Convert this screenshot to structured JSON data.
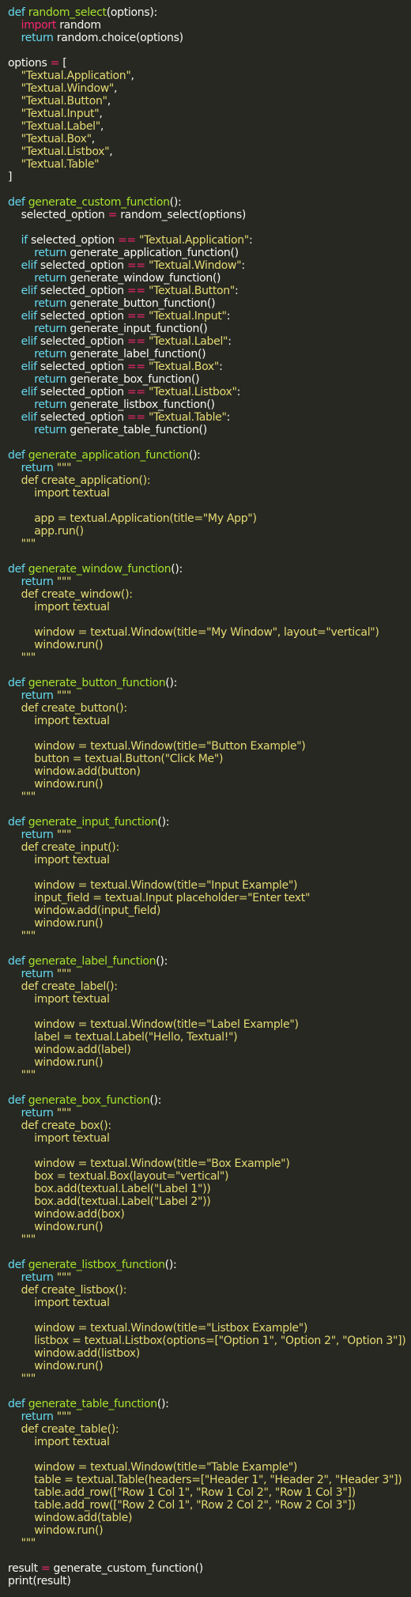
{
  "theme": {
    "background": "#272822",
    "foreground": "#f8f8f2",
    "keyword": "#66d9ef",
    "import_keyword": "#f92672",
    "function_name": "#a6e22e",
    "string": "#e6db74",
    "operator": "#f92672"
  },
  "lines": [
    [
      {
        "t": "kw",
        "v": "def "
      },
      {
        "t": "fn",
        "v": "random_select"
      },
      {
        "t": "plain",
        "v": "(options):"
      }
    ],
    [
      {
        "t": "plain",
        "v": "    "
      },
      {
        "t": "imp",
        "v": "import"
      },
      {
        "t": "plain",
        "v": " random"
      }
    ],
    [
      {
        "t": "plain",
        "v": "    "
      },
      {
        "t": "kw",
        "v": "return"
      },
      {
        "t": "plain",
        "v": " random.choice(options)"
      }
    ],
    [],
    [
      {
        "t": "plain",
        "v": "options "
      },
      {
        "t": "op",
        "v": "="
      },
      {
        "t": "plain",
        "v": " ["
      }
    ],
    [
      {
        "t": "plain",
        "v": "    "
      },
      {
        "t": "str",
        "v": "\"Textual.Application\""
      },
      {
        "t": "plain",
        "v": ","
      }
    ],
    [
      {
        "t": "plain",
        "v": "    "
      },
      {
        "t": "str",
        "v": "\"Textual.Window\""
      },
      {
        "t": "plain",
        "v": ","
      }
    ],
    [
      {
        "t": "plain",
        "v": "    "
      },
      {
        "t": "str",
        "v": "\"Textual.Button\""
      },
      {
        "t": "plain",
        "v": ","
      }
    ],
    [
      {
        "t": "plain",
        "v": "    "
      },
      {
        "t": "str",
        "v": "\"Textual.Input\""
      },
      {
        "t": "plain",
        "v": ","
      }
    ],
    [
      {
        "t": "plain",
        "v": "    "
      },
      {
        "t": "str",
        "v": "\"Textual.Label\""
      },
      {
        "t": "plain",
        "v": ","
      }
    ],
    [
      {
        "t": "plain",
        "v": "    "
      },
      {
        "t": "str",
        "v": "\"Textual.Box\""
      },
      {
        "t": "plain",
        "v": ","
      }
    ],
    [
      {
        "t": "plain",
        "v": "    "
      },
      {
        "t": "str",
        "v": "\"Textual.Listbox\""
      },
      {
        "t": "plain",
        "v": ","
      }
    ],
    [
      {
        "t": "plain",
        "v": "    "
      },
      {
        "t": "str",
        "v": "\"Textual.Table\""
      }
    ],
    [
      {
        "t": "plain",
        "v": "]"
      }
    ],
    [],
    [
      {
        "t": "kw",
        "v": "def "
      },
      {
        "t": "fn",
        "v": "generate_custom_function"
      },
      {
        "t": "plain",
        "v": "():"
      }
    ],
    [
      {
        "t": "plain",
        "v": "    selected_option "
      },
      {
        "t": "op",
        "v": "="
      },
      {
        "t": "plain",
        "v": " random_select(options)"
      }
    ],
    [],
    [
      {
        "t": "plain",
        "v": "    "
      },
      {
        "t": "kw",
        "v": "if"
      },
      {
        "t": "plain",
        "v": " selected_option "
      },
      {
        "t": "op",
        "v": "=="
      },
      {
        "t": "plain",
        "v": " "
      },
      {
        "t": "str",
        "v": "\"Textual.Application\""
      },
      {
        "t": "plain",
        "v": ":"
      }
    ],
    [
      {
        "t": "plain",
        "v": "        "
      },
      {
        "t": "kw",
        "v": "return"
      },
      {
        "t": "plain",
        "v": " generate_application_function()"
      }
    ],
    [
      {
        "t": "plain",
        "v": "    "
      },
      {
        "t": "kw",
        "v": "elif"
      },
      {
        "t": "plain",
        "v": " selected_option "
      },
      {
        "t": "op",
        "v": "=="
      },
      {
        "t": "plain",
        "v": " "
      },
      {
        "t": "str",
        "v": "\"Textual.Window\""
      },
      {
        "t": "plain",
        "v": ":"
      }
    ],
    [
      {
        "t": "plain",
        "v": "        "
      },
      {
        "t": "kw",
        "v": "return"
      },
      {
        "t": "plain",
        "v": " generate_window_function()"
      }
    ],
    [
      {
        "t": "plain",
        "v": "    "
      },
      {
        "t": "kw",
        "v": "elif"
      },
      {
        "t": "plain",
        "v": " selected_option "
      },
      {
        "t": "op",
        "v": "=="
      },
      {
        "t": "plain",
        "v": " "
      },
      {
        "t": "str",
        "v": "\"Textual.Button\""
      },
      {
        "t": "plain",
        "v": ":"
      }
    ],
    [
      {
        "t": "plain",
        "v": "        "
      },
      {
        "t": "kw",
        "v": "return"
      },
      {
        "t": "plain",
        "v": " generate_button_function()"
      }
    ],
    [
      {
        "t": "plain",
        "v": "    "
      },
      {
        "t": "kw",
        "v": "elif"
      },
      {
        "t": "plain",
        "v": " selected_option "
      },
      {
        "t": "op",
        "v": "=="
      },
      {
        "t": "plain",
        "v": " "
      },
      {
        "t": "str",
        "v": "\"Textual.Input\""
      },
      {
        "t": "plain",
        "v": ":"
      }
    ],
    [
      {
        "t": "plain",
        "v": "        "
      },
      {
        "t": "kw",
        "v": "return"
      },
      {
        "t": "plain",
        "v": " generate_input_function()"
      }
    ],
    [
      {
        "t": "plain",
        "v": "    "
      },
      {
        "t": "kw",
        "v": "elif"
      },
      {
        "t": "plain",
        "v": " selected_option "
      },
      {
        "t": "op",
        "v": "=="
      },
      {
        "t": "plain",
        "v": " "
      },
      {
        "t": "str",
        "v": "\"Textual.Label\""
      },
      {
        "t": "plain",
        "v": ":"
      }
    ],
    [
      {
        "t": "plain",
        "v": "        "
      },
      {
        "t": "kw",
        "v": "return"
      },
      {
        "t": "plain",
        "v": " generate_label_function()"
      }
    ],
    [
      {
        "t": "plain",
        "v": "    "
      },
      {
        "t": "kw",
        "v": "elif"
      },
      {
        "t": "plain",
        "v": " selected_option "
      },
      {
        "t": "op",
        "v": "=="
      },
      {
        "t": "plain",
        "v": " "
      },
      {
        "t": "str",
        "v": "\"Textual.Box\""
      },
      {
        "t": "plain",
        "v": ":"
      }
    ],
    [
      {
        "t": "plain",
        "v": "        "
      },
      {
        "t": "kw",
        "v": "return"
      },
      {
        "t": "plain",
        "v": " generate_box_function()"
      }
    ],
    [
      {
        "t": "plain",
        "v": "    "
      },
      {
        "t": "kw",
        "v": "elif"
      },
      {
        "t": "plain",
        "v": " selected_option "
      },
      {
        "t": "op",
        "v": "=="
      },
      {
        "t": "plain",
        "v": " "
      },
      {
        "t": "str",
        "v": "\"Textual.Listbox\""
      },
      {
        "t": "plain",
        "v": ":"
      }
    ],
    [
      {
        "t": "plain",
        "v": "        "
      },
      {
        "t": "kw",
        "v": "return"
      },
      {
        "t": "plain",
        "v": " generate_listbox_function()"
      }
    ],
    [
      {
        "t": "plain",
        "v": "    "
      },
      {
        "t": "kw",
        "v": "elif"
      },
      {
        "t": "plain",
        "v": " selected_option "
      },
      {
        "t": "op",
        "v": "=="
      },
      {
        "t": "plain",
        "v": " "
      },
      {
        "t": "str",
        "v": "\"Textual.Table\""
      },
      {
        "t": "plain",
        "v": ":"
      }
    ],
    [
      {
        "t": "plain",
        "v": "        "
      },
      {
        "t": "kw",
        "v": "return"
      },
      {
        "t": "plain",
        "v": " generate_table_function()"
      }
    ],
    [],
    [
      {
        "t": "kw",
        "v": "def "
      },
      {
        "t": "fn",
        "v": "generate_application_function"
      },
      {
        "t": "plain",
        "v": "():"
      }
    ],
    [
      {
        "t": "plain",
        "v": "    "
      },
      {
        "t": "kw",
        "v": "return"
      },
      {
        "t": "plain",
        "v": " "
      },
      {
        "t": "str",
        "v": "\"\"\""
      }
    ],
    [
      {
        "t": "str",
        "v": "    def create_application():"
      }
    ],
    [
      {
        "t": "str",
        "v": "        import textual"
      }
    ],
    [],
    [
      {
        "t": "str",
        "v": "        app = textual.Application(title=\"My App\")"
      }
    ],
    [
      {
        "t": "str",
        "v": "        app.run()"
      }
    ],
    [
      {
        "t": "str",
        "v": "    \"\"\""
      }
    ],
    [],
    [
      {
        "t": "kw",
        "v": "def "
      },
      {
        "t": "fn",
        "v": "generate_window_function"
      },
      {
        "t": "plain",
        "v": "():"
      }
    ],
    [
      {
        "t": "plain",
        "v": "    "
      },
      {
        "t": "kw",
        "v": "return"
      },
      {
        "t": "plain",
        "v": " "
      },
      {
        "t": "str",
        "v": "\"\"\""
      }
    ],
    [
      {
        "t": "str",
        "v": "    def create_window():"
      }
    ],
    [
      {
        "t": "str",
        "v": "        import textual"
      }
    ],
    [],
    [
      {
        "t": "str",
        "v": "        window = textual.Window(title=\"My Window\", layout=\"vertical\")"
      }
    ],
    [
      {
        "t": "str",
        "v": "        window.run()"
      }
    ],
    [
      {
        "t": "str",
        "v": "    \"\"\""
      }
    ],
    [],
    [
      {
        "t": "kw",
        "v": "def "
      },
      {
        "t": "fn",
        "v": "generate_button_function"
      },
      {
        "t": "plain",
        "v": "():"
      }
    ],
    [
      {
        "t": "plain",
        "v": "    "
      },
      {
        "t": "kw",
        "v": "return"
      },
      {
        "t": "plain",
        "v": " "
      },
      {
        "t": "str",
        "v": "\"\"\""
      }
    ],
    [
      {
        "t": "str",
        "v": "    def create_button():"
      }
    ],
    [
      {
        "t": "str",
        "v": "        import textual"
      }
    ],
    [],
    [
      {
        "t": "str",
        "v": "        window = textual.Window(title=\"Button Example\")"
      }
    ],
    [
      {
        "t": "str",
        "v": "        button = textual.Button(\"Click Me\")"
      }
    ],
    [
      {
        "t": "str",
        "v": "        window.add(button)"
      }
    ],
    [
      {
        "t": "str",
        "v": "        window.run()"
      }
    ],
    [
      {
        "t": "str",
        "v": "    \"\"\""
      }
    ],
    [],
    [
      {
        "t": "kw",
        "v": "def "
      },
      {
        "t": "fn",
        "v": "generate_input_function"
      },
      {
        "t": "plain",
        "v": "():"
      }
    ],
    [
      {
        "t": "plain",
        "v": "    "
      },
      {
        "t": "kw",
        "v": "return"
      },
      {
        "t": "plain",
        "v": " "
      },
      {
        "t": "str",
        "v": "\"\"\""
      }
    ],
    [
      {
        "t": "str",
        "v": "    def create_input():"
      }
    ],
    [
      {
        "t": "str",
        "v": "        import textual"
      }
    ],
    [],
    [
      {
        "t": "str",
        "v": "        window = textual.Window(title=\"Input Example\")"
      }
    ],
    [
      {
        "t": "str",
        "v": "        input_field = textual.Input placeholder=\"Enter text\""
      }
    ],
    [
      {
        "t": "str",
        "v": "        window.add(input_field)"
      }
    ],
    [
      {
        "t": "str",
        "v": "        window.run()"
      }
    ],
    [
      {
        "t": "str",
        "v": "    \"\"\""
      }
    ],
    [],
    [
      {
        "t": "kw",
        "v": "def "
      },
      {
        "t": "fn",
        "v": "generate_label_function"
      },
      {
        "t": "plain",
        "v": "():"
      }
    ],
    [
      {
        "t": "plain",
        "v": "    "
      },
      {
        "t": "kw",
        "v": "return"
      },
      {
        "t": "plain",
        "v": " "
      },
      {
        "t": "str",
        "v": "\"\"\""
      }
    ],
    [
      {
        "t": "str",
        "v": "    def create_label():"
      }
    ],
    [
      {
        "t": "str",
        "v": "        import textual"
      }
    ],
    [],
    [
      {
        "t": "str",
        "v": "        window = textual.Window(title=\"Label Example\")"
      }
    ],
    [
      {
        "t": "str",
        "v": "        label = textual.Label(\"Hello, Textual!\")"
      }
    ],
    [
      {
        "t": "str",
        "v": "        window.add(label)"
      }
    ],
    [
      {
        "t": "str",
        "v": "        window.run()"
      }
    ],
    [
      {
        "t": "str",
        "v": "    \"\"\""
      }
    ],
    [],
    [
      {
        "t": "kw",
        "v": "def "
      },
      {
        "t": "fn",
        "v": "generate_box_function"
      },
      {
        "t": "plain",
        "v": "():"
      }
    ],
    [
      {
        "t": "plain",
        "v": "    "
      },
      {
        "t": "kw",
        "v": "return"
      },
      {
        "t": "plain",
        "v": " "
      },
      {
        "t": "str",
        "v": "\"\"\""
      }
    ],
    [
      {
        "t": "str",
        "v": "    def create_box():"
      }
    ],
    [
      {
        "t": "str",
        "v": "        import textual"
      }
    ],
    [],
    [
      {
        "t": "str",
        "v": "        window = textual.Window(title=\"Box Example\")"
      }
    ],
    [
      {
        "t": "str",
        "v": "        box = textual.Box(layout=\"vertical\")"
      }
    ],
    [
      {
        "t": "str",
        "v": "        box.add(textual.Label(\"Label 1\"))"
      }
    ],
    [
      {
        "t": "str",
        "v": "        box.add(textual.Label(\"Label 2\"))"
      }
    ],
    [
      {
        "t": "str",
        "v": "        window.add(box)"
      }
    ],
    [
      {
        "t": "str",
        "v": "        window.run()"
      }
    ],
    [
      {
        "t": "str",
        "v": "    \"\"\""
      }
    ],
    [],
    [
      {
        "t": "kw",
        "v": "def "
      },
      {
        "t": "fn",
        "v": "generate_listbox_function"
      },
      {
        "t": "plain",
        "v": "():"
      }
    ],
    [
      {
        "t": "plain",
        "v": "    "
      },
      {
        "t": "kw",
        "v": "return"
      },
      {
        "t": "plain",
        "v": " "
      },
      {
        "t": "str",
        "v": "\"\"\""
      }
    ],
    [
      {
        "t": "str",
        "v": "    def create_listbox():"
      }
    ],
    [
      {
        "t": "str",
        "v": "        import textual"
      }
    ],
    [],
    [
      {
        "t": "str",
        "v": "        window = textual.Window(title=\"Listbox Example\")"
      }
    ],
    [
      {
        "t": "str",
        "v": "        listbox = textual.Listbox(options=[\"Option 1\", \"Option 2\", \"Option 3\"])"
      }
    ],
    [
      {
        "t": "str",
        "v": "        window.add(listbox)"
      }
    ],
    [
      {
        "t": "str",
        "v": "        window.run()"
      }
    ],
    [
      {
        "t": "str",
        "v": "    \"\"\""
      }
    ],
    [],
    [
      {
        "t": "kw",
        "v": "def "
      },
      {
        "t": "fn",
        "v": "generate_table_function"
      },
      {
        "t": "plain",
        "v": "():"
      }
    ],
    [
      {
        "t": "plain",
        "v": "    "
      },
      {
        "t": "kw",
        "v": "return"
      },
      {
        "t": "plain",
        "v": " "
      },
      {
        "t": "str",
        "v": "\"\"\""
      }
    ],
    [
      {
        "t": "str",
        "v": "    def create_table():"
      }
    ],
    [
      {
        "t": "str",
        "v": "        import textual"
      }
    ],
    [],
    [
      {
        "t": "str",
        "v": "        window = textual.Window(title=\"Table Example\")"
      }
    ],
    [
      {
        "t": "str",
        "v": "        table = textual.Table(headers=[\"Header 1\", \"Header 2\", \"Header 3\"])"
      }
    ],
    [
      {
        "t": "str",
        "v": "        table.add_row([\"Row 1 Col 1\", \"Row 1 Col 2\", \"Row 1 Col 3\"])"
      }
    ],
    [
      {
        "t": "str",
        "v": "        table.add_row([\"Row 2 Col 1\", \"Row 2 Col 2\", \"Row 2 Col 3\"])"
      }
    ],
    [
      {
        "t": "str",
        "v": "        window.add(table)"
      }
    ],
    [
      {
        "t": "str",
        "v": "        window.run()"
      }
    ],
    [
      {
        "t": "str",
        "v": "    \"\"\""
      }
    ],
    [],
    [
      {
        "t": "plain",
        "v": "result "
      },
      {
        "t": "op",
        "v": "="
      },
      {
        "t": "plain",
        "v": " generate_custom_function()"
      }
    ],
    [
      {
        "t": "plain",
        "v": "print(result)"
      }
    ]
  ]
}
